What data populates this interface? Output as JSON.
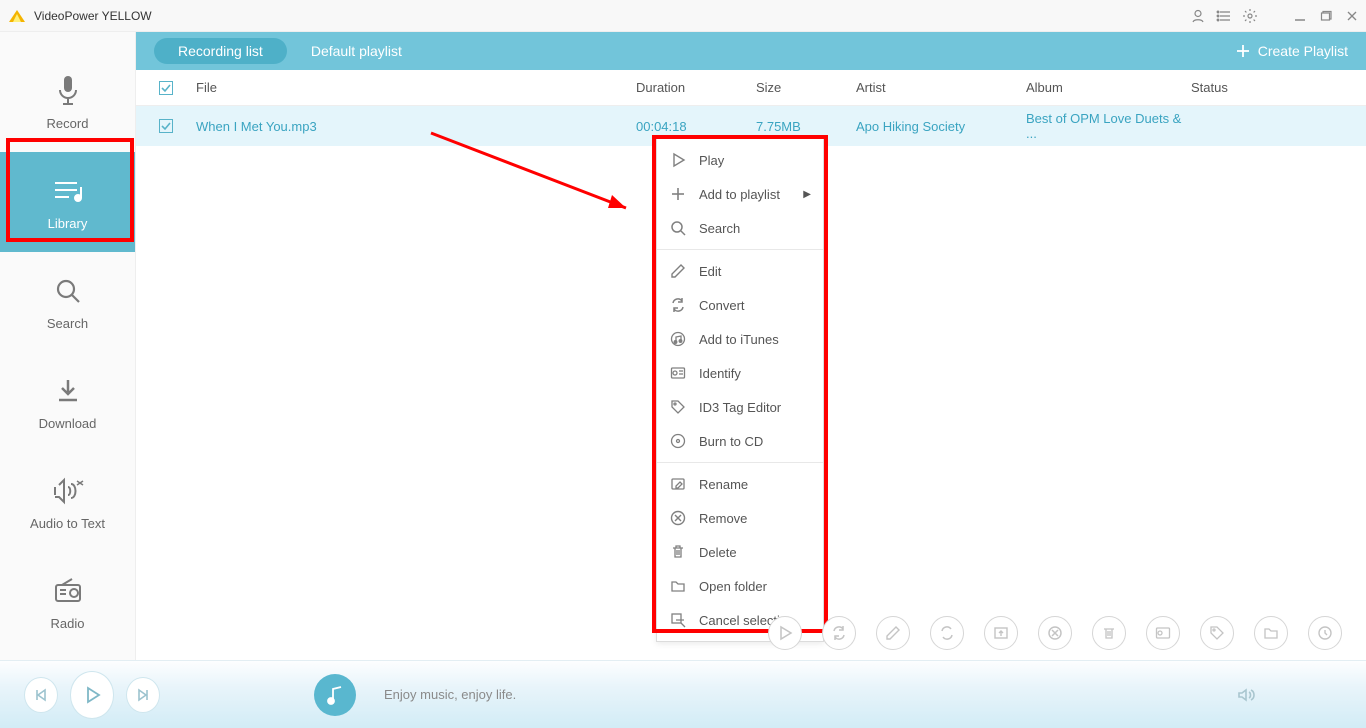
{
  "app": {
    "title": "VideoPower YELLOW"
  },
  "sidebar": {
    "items": [
      {
        "label": "Record"
      },
      {
        "label": "Library"
      },
      {
        "label": "Search"
      },
      {
        "label": "Download"
      },
      {
        "label": "Audio to Text"
      },
      {
        "label": "Radio"
      }
    ]
  },
  "tabs": {
    "recording_list": "Recording list",
    "default_playlist": "Default playlist",
    "create_playlist": "Create Playlist"
  },
  "table": {
    "headers": {
      "file": "File",
      "duration": "Duration",
      "size": "Size",
      "artist": "Artist",
      "album": "Album",
      "status": "Status"
    },
    "rows": [
      {
        "file": "When I Met You.mp3",
        "duration": "00:04:18",
        "size": "7.75MB",
        "artist": "Apo Hiking Society",
        "album": "Best of OPM Love Duets & ...",
        "status": ""
      }
    ]
  },
  "context_menu": {
    "play": "Play",
    "add_to_playlist": "Add to playlist",
    "search": "Search",
    "edit": "Edit",
    "convert": "Convert",
    "add_to_itunes": "Add to iTunes",
    "identify": "Identify",
    "id3_tag": "ID3 Tag Editor",
    "burn": "Burn to CD",
    "rename": "Rename",
    "remove": "Remove",
    "delete": "Delete",
    "open_folder": "Open folder",
    "cancel_selection": "Cancel selection"
  },
  "player": {
    "tagline": "Enjoy music, enjoy life."
  },
  "colors": {
    "accent": "#60b9ce",
    "accent_dark": "#4eb0c8",
    "link": "#3aa4c1",
    "highlight_red": "#ff0000"
  }
}
